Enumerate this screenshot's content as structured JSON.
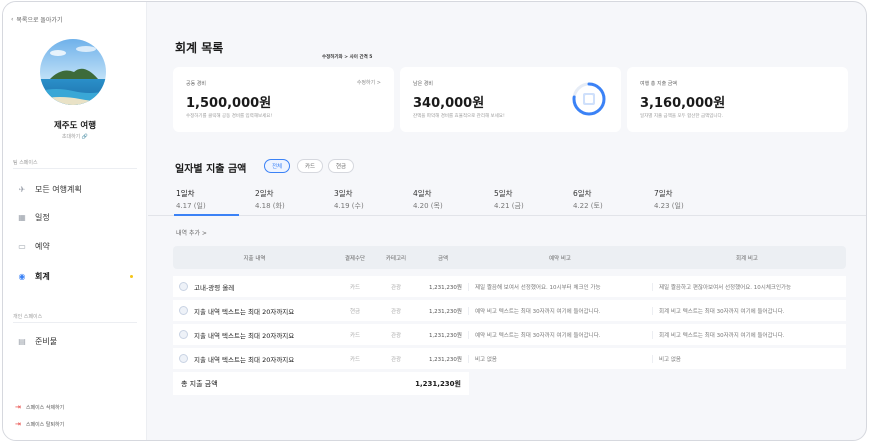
{
  "sidebar": {
    "back_label": "목록으로 돌아가기",
    "trip_name": "제주도 여행",
    "invite_label": "초대하기",
    "team_space_label": "팀 스페이스",
    "personal_space_label": "개인 스페이스",
    "items": [
      {
        "label": "모든 여행계획",
        "icon": "airplane-icon"
      },
      {
        "label": "일정",
        "icon": "calendar-icon"
      },
      {
        "label": "예약",
        "icon": "card-icon"
      },
      {
        "label": "회계",
        "icon": "accounting-icon",
        "active": true
      },
      {
        "label": "준비물",
        "icon": "clipboard-icon"
      }
    ],
    "footer": [
      {
        "label": "스페이스 삭제하기",
        "icon": "exit-icon"
      },
      {
        "label": "스페이스 탈퇴하기",
        "icon": "exit-icon"
      }
    ]
  },
  "main": {
    "title": "회계 목록",
    "hint": "수정하기와 > 사이 간격 5",
    "cards": [
      {
        "label": "공동 경비",
        "value": "1,500,000원",
        "sub": "수정하기를 클릭해 공동 경비를 입력해보세요!",
        "action": "수정하기 >"
      },
      {
        "label": "남은 경비",
        "value": "340,000원",
        "sub": "잔액을 파악해 경비를 효율적으로 관리해 보세요!",
        "remaining_ratio": 0.23
      },
      {
        "label": "여행 총 지출 금액",
        "value": "3,160,000원",
        "sub": "일자별 지출 금액을 모두 합산한 금액입니다."
      }
    ],
    "daily_title": "일자별 지출 금액",
    "filters": [
      "전체",
      "카드",
      "현금"
    ],
    "active_filter": "전체",
    "days": [
      {
        "day": "1일차",
        "date": "4.17 (일)"
      },
      {
        "day": "2일차",
        "date": "4.18 (화)"
      },
      {
        "day": "3일차",
        "date": "4.19 (수)"
      },
      {
        "day": "4일차",
        "date": "4.20 (목)"
      },
      {
        "day": "5일차",
        "date": "4.21 (금)"
      },
      {
        "day": "6일차",
        "date": "4.22 (토)"
      },
      {
        "day": "7일차",
        "date": "4.23 (일)"
      }
    ],
    "add_label": "내역 추가 >",
    "columns": [
      "지출 내역",
      "결제수단",
      "카테고리",
      "금액",
      "예약 비고",
      "회계 비고"
    ],
    "rows": [
      {
        "name": "고내-광령 올레",
        "pay": "카드",
        "cat": "관광",
        "amt": "1,231,230원",
        "memo": "제일 짤끔해 보여서 선정했어요. 10시부터 체크인 가능",
        "note": "제일 짤끔하고 편잖아보여서 선정했어요. 10시체크인가능"
      },
      {
        "name": "지출 내역 텍스트는 최대 20자까지요",
        "pay": "현금",
        "cat": "관광",
        "amt": "1,231,230원",
        "memo": "예약 비고 텍스트는 최대 30자까지 여기에 들어갑니다.",
        "note": "회계 비고 텍스트는 최대 30자까지 여기에 들어갑니다."
      },
      {
        "name": "지출 내역 텍스트는 최대 20자까지요",
        "pay": "카드",
        "cat": "관광",
        "amt": "1,231,230원",
        "memo": "예약 비고 텍스트는 최대 30자까지 여기에 들어갑니다.",
        "note": "회계 비고 텍스트는 최대 30자까지 여기에 들어갑니다."
      },
      {
        "name": "지출 내역 텍스트는 최대 20자까지요",
        "pay": "카드",
        "cat": "관광",
        "amt": "1,231,230원",
        "memo": "비고 없음",
        "note": "비고 없음"
      }
    ],
    "total_label": "총 지출 금액",
    "total_amt": "1,231,230원"
  },
  "colors": {
    "accent": "#3b82f6",
    "highlight": "#f5c518",
    "danger": "#e53935"
  }
}
